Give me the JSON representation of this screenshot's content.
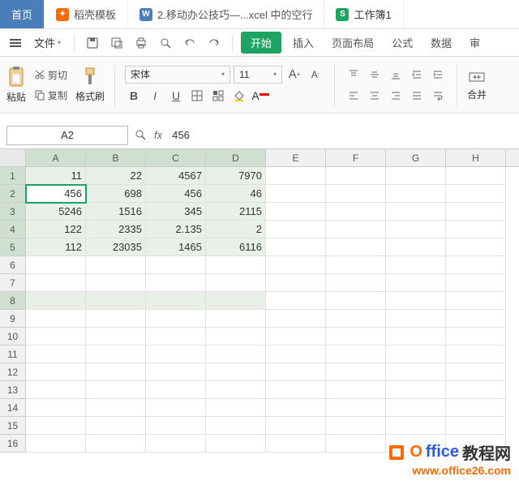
{
  "tabs": {
    "home": "首页",
    "docer": "稻壳模板",
    "doc": "2.移动办公技巧—...xcel 中的空行",
    "sheet": "工作簿1"
  },
  "menubar": {
    "file": "文件",
    "start": "开始",
    "insert": "插入",
    "page_layout": "页面布局",
    "formula": "公式",
    "data": "数据",
    "review": "审"
  },
  "ribbon": {
    "cut": "剪切",
    "copy": "复制",
    "paste": "粘贴",
    "format_painter": "格式刷",
    "font_name": "宋体",
    "font_size": "11",
    "merge": "合并"
  },
  "formula_bar": {
    "name_box": "A2",
    "value": "456"
  },
  "columns": [
    "A",
    "B",
    "C",
    "D",
    "E",
    "F",
    "G",
    "H"
  ],
  "row_numbers": [
    "1",
    "2",
    "3",
    "4",
    "5",
    "6",
    "7",
    "8",
    "9",
    "10",
    "11",
    "12",
    "13",
    "14",
    "15",
    "16"
  ],
  "chart_data": {
    "type": "table",
    "columns": [
      "A",
      "B",
      "C",
      "D"
    ],
    "rows": [
      [
        11,
        22,
        4567,
        7970
      ],
      [
        456,
        698,
        456,
        46
      ],
      [
        5246,
        1516,
        345,
        2115
      ],
      [
        122,
        2335,
        "2.135",
        2
      ],
      [
        112,
        23035,
        1465,
        6116
      ]
    ]
  },
  "watermark": {
    "brand_o": "O",
    "brand_ffice": "ffice",
    "brand_cn": "教程网",
    "url": "www.office26.com"
  }
}
